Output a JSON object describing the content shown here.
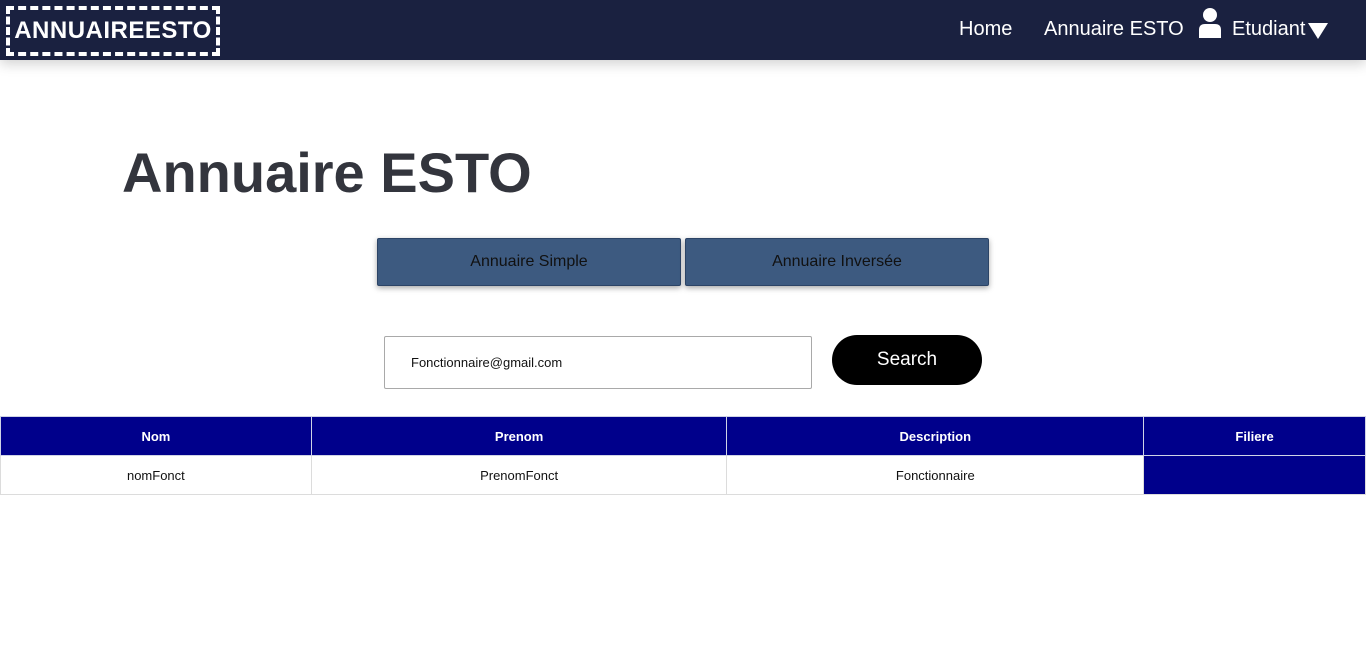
{
  "navbar": {
    "logo": "ANNUAIREESTO",
    "links": [
      "Home",
      "Annuaire ESTO"
    ],
    "user_label": "Etudiant",
    "user_icon": "user-icon",
    "dropdown_icon": "caret-down-icon",
    "background": "#1a2140"
  },
  "main": {
    "title": "Annuaire ESTO",
    "modes": [
      "Annuaire Simple",
      "Annuaire Inversée"
    ],
    "search": {
      "value": "Fonctionnaire@gmail.com",
      "button_label": "Search"
    }
  },
  "table": {
    "headers": [
      "Nom",
      "Prenom",
      "Description",
      "Filiere"
    ],
    "rows": [
      [
        "nomFonct",
        "PrenomFonct",
        "Fonctionnaire",
        ""
      ]
    ],
    "header_color": "#00008b"
  }
}
